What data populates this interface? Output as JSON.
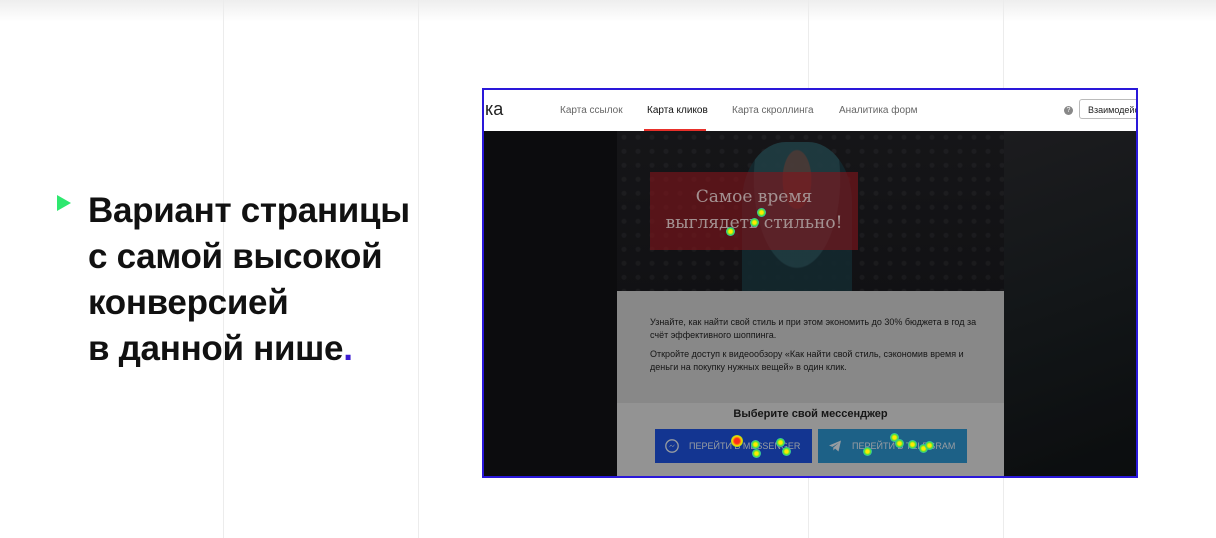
{
  "headline": {
    "lines": [
      "Вариант страницы",
      "с самой высокой",
      "конверсией",
      "в данной нише"
    ],
    "dot": "."
  },
  "screenshot": {
    "brand": "ка",
    "tabs": [
      {
        "label": "Карта ссылок",
        "active": false
      },
      {
        "label": "Карта кликов",
        "active": true
      },
      {
        "label": "Карта скроллинга",
        "active": false
      },
      {
        "label": "Аналитика форм",
        "active": false
      }
    ],
    "help_icon": "question-icon",
    "interact_label": "Взаимодейст",
    "hero_text": [
      "Самое время",
      "выглядеть стильно!"
    ],
    "offer_paragraphs": [
      "Узнайте, как найти свой стиль и при этом экономить до 30% бюджета в год за счёт эффективного шоппинга.",
      "Откройте доступ к видеообзору «Как найти свой стиль, сэкономив время и деньги на покупку нужных вещей» в один клик."
    ],
    "messenger_title": "Выберите свой мессенджер",
    "buttons": [
      {
        "label": "ПЕРЕЙТИ В MESSENGER",
        "icon": "messenger-icon",
        "color": "#1c4fd6"
      },
      {
        "label": "ПЕРЕЙТИ В TELEGRAM",
        "icon": "telegram-icon",
        "color": "#2c8fc7"
      }
    ]
  },
  "colors": {
    "accent_green": "#2ee86f",
    "frame_blue": "#2a18d9",
    "active_tab_underline": "#e8302a"
  }
}
